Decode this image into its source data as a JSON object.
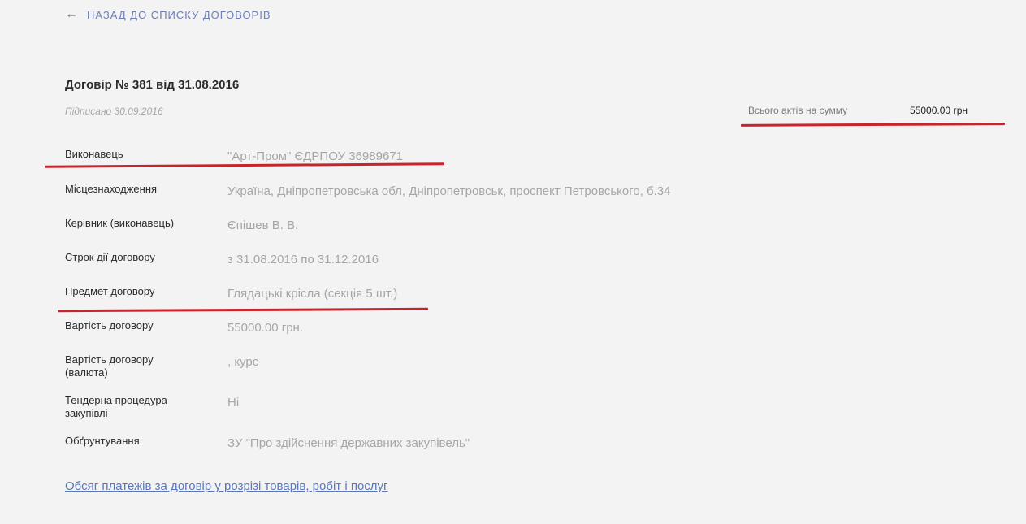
{
  "nav": {
    "back_label": "НАЗАД ДО СПИСКУ ДОГОВОРІВ"
  },
  "contract": {
    "title": "Договір № 381 від 31.08.2016",
    "signed": "Підписано 30.09.2016"
  },
  "summary": {
    "label": "Всього актів на сумму",
    "value": "55000.00 грн"
  },
  "details": [
    {
      "label": "Виконавець",
      "value": "\"Арт-Пром\" ЄДРПОУ 36989671"
    },
    {
      "label": "Місцезнаходження",
      "value": "Україна, Дніпропетровська обл, Дніпропетровськ, проспект Петровського, б.34"
    },
    {
      "label": "Керівник (виконавець)",
      "value": "Єпішев В. В."
    },
    {
      "label": "Строк дії договору",
      "value": "з 31.08.2016 по 31.12.2016"
    },
    {
      "label": "Предмет договору",
      "value": "Глядацькі крісла (секція 5 шт.)"
    },
    {
      "label": "Вартість договору",
      "value": "55000.00 грн."
    },
    {
      "label": "Вартість договору (валюта)",
      "value": ", курс"
    },
    {
      "label": "Тендерна процедура закупівлі",
      "value": "Ні"
    },
    {
      "label": "Обґрунтування",
      "value": "ЗУ \"Про здійснення державних закупівель\""
    }
  ],
  "footer": {
    "payments_link": "Обсяг платежів за договір у розрізі товарів, робіт і послуг"
  },
  "colors": {
    "background": "#f3f3f4",
    "link": "#6f7fb3",
    "annotation_red": "#c8242c"
  }
}
